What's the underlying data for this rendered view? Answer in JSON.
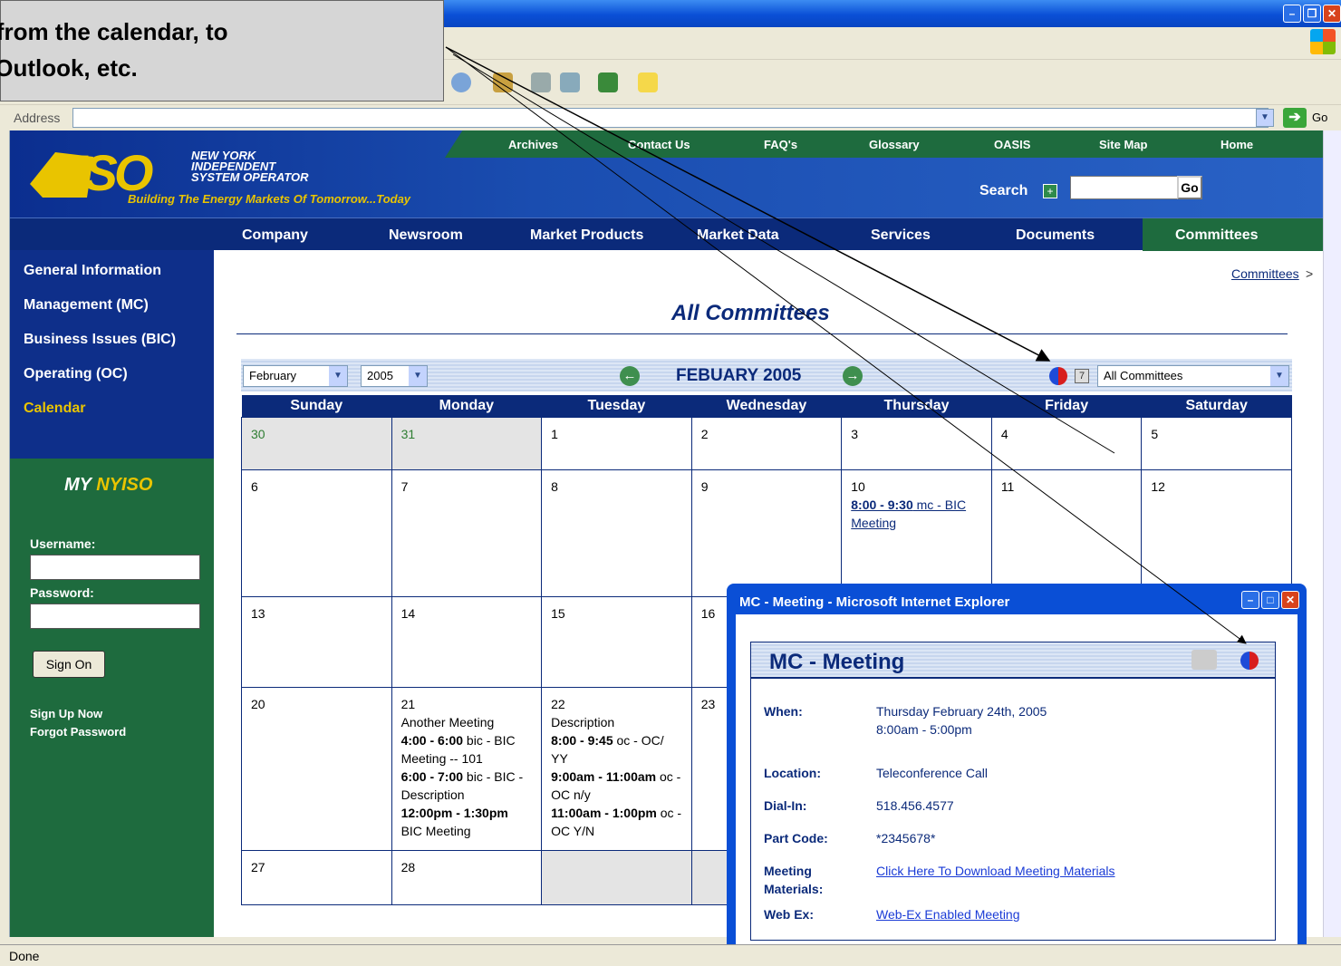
{
  "callout": {
    "line1": "tes from the calendar, to",
    "line2": "A, Outlook, etc."
  },
  "address": {
    "label": "Address",
    "go": "Go"
  },
  "header": {
    "org": [
      "NEW YORK",
      "INDEPENDENT",
      "SYSTEM OPERATOR"
    ],
    "tagline": "Building The Energy Markets Of Tomorrow...Today",
    "util_nav": [
      "Archives",
      "Contact Us",
      "FAQ's",
      "Glossary",
      "OASIS",
      "Site Map",
      "Home"
    ],
    "search_label": "Search",
    "search_go": "Go"
  },
  "main_nav": [
    "Company",
    "Newsroom",
    "Market Products",
    "Market Data",
    "Services",
    "Documents",
    "Committees"
  ],
  "sidebar": [
    "General Information",
    "Management (MC)",
    "Business Issues (BIC)",
    "Operating (OC)",
    "Calendar"
  ],
  "my_nyiso": {
    "my": "MY",
    "nyiso": "NYISO",
    "username": "Username:",
    "password": "Password:",
    "signon": "Sign On",
    "signup": "Sign Up Now",
    "forgot": "Forgot Password"
  },
  "breadcrumb": "Committees",
  "page_title": "All Committees",
  "calendar": {
    "month_select": "February",
    "year_select": "2005",
    "heading": "FEBUARY 2005",
    "filter": "All Committees",
    "days": [
      "Sunday",
      "Monday",
      "Tuesday",
      "Wednesday",
      "Thursday",
      "Friday",
      "Saturday"
    ],
    "weeks": [
      [
        {
          "d": "30",
          "other": true
        },
        {
          "d": "31",
          "other": true
        },
        {
          "d": "1"
        },
        {
          "d": "2"
        },
        {
          "d": "3"
        },
        {
          "d": "4"
        },
        {
          "d": "5"
        }
      ],
      [
        {
          "d": "6"
        },
        {
          "d": "7"
        },
        {
          "d": "8"
        },
        {
          "d": "9"
        },
        {
          "d": "10",
          "events": [
            {
              "time": "8:00 - 9:30",
              "text": " mc - BIC Meeting",
              "link": true
            }
          ]
        },
        {
          "d": "11"
        },
        {
          "d": "12"
        }
      ],
      [
        {
          "d": "13"
        },
        {
          "d": "14"
        },
        {
          "d": "15"
        },
        {
          "d": "16"
        },
        {
          "d": ""
        },
        {
          "d": ""
        },
        {
          "d": ""
        }
      ],
      [
        {
          "d": "20"
        },
        {
          "d": "21",
          "events": [
            {
              "time": "",
              "text": "Another Meeting"
            },
            {
              "time": "4:00 - 6:00",
              "text": " bic - BIC Meeting -- 101"
            },
            {
              "time": "6:00 - 7:00",
              "text": " bic - BIC - Description"
            },
            {
              "time": "12:00pm - 1:30pm",
              "text": " BIC Meeting"
            }
          ]
        },
        {
          "d": "22",
          "events": [
            {
              "time": "",
              "text": "Description"
            },
            {
              "time": "8:00 - 9:45",
              "text": " oc - OC/ YY"
            },
            {
              "time": "9:00am - 11:00am",
              "text": " oc - OC n/y"
            },
            {
              "time": "11:00am - 1:00pm",
              "text": " oc - OC Y/N"
            }
          ]
        },
        {
          "d": "23"
        },
        {
          "d": ""
        },
        {
          "d": ""
        },
        {
          "d": ""
        }
      ],
      [
        {
          "d": "27"
        },
        {
          "d": "28"
        },
        {
          "d": "",
          "empty": true
        },
        {
          "d": "",
          "empty": true
        },
        {
          "d": ""
        },
        {
          "d": ""
        },
        {
          "d": ""
        }
      ]
    ]
  },
  "popup": {
    "title": "MC - Meeting - Microsoft Internet Explorer",
    "heading": "MC - Meeting",
    "when_label": "When:",
    "when_date": "Thursday February 24th, 2005",
    "when_time": "8:00am - 5:00pm",
    "location_label": "Location:",
    "location": "Teleconference Call",
    "dialin_label": "Dial-In:",
    "dialin": "518.456.4577",
    "partcode_label": "Part Code:",
    "partcode": "*2345678*",
    "materials_label1": "Meeting",
    "materials_label2": "Materials:",
    "materials_link": "Click Here To Download Meeting Materials",
    "webex_label": "Web Ex:",
    "webex_link": "Web-Ex Enabled Meeting"
  },
  "status": "Done"
}
